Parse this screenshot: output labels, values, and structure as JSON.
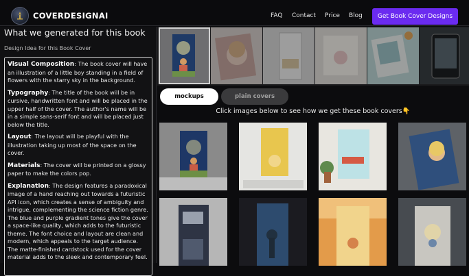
{
  "nav": {
    "brand": "COVERDESIGNAI",
    "links": [
      "FAQ",
      "Contact",
      "Price",
      "Blog"
    ],
    "cta": "Get Book Cover Designs"
  },
  "left": {
    "title": "What we generated for this book",
    "subtitle": "Design Idea for this Book Cover",
    "sections": [
      {
        "heading": "Visual Composition",
        "text": ": The book cover will have an illustration of a little boy standing in a field of flowers with the starry sky in the background."
      },
      {
        "heading": "Typography",
        "text": ": The title of the book will be in cursive, handwritten font and will be placed in the upper half of the cover. The author's name will be in a simple sans-serif font and will be placed just below the title."
      },
      {
        "heading": "Layout",
        "text": ": The layout will be playful with the illustration taking up most of the space on the cover."
      },
      {
        "heading": "Materials",
        "text": ": The cover will be printed on a glossy paper to make the colors pop."
      },
      {
        "heading": "Explanation",
        "text": ": The design features a paradoxical image of a hand reaching out towards a futuristic API icon, which creates a sense of ambiguity and intrigue, complementing the science fiction genre. The blue and purple gradient tones give the cover a space-like quality, which adds to the futuristic theme. The font choice and layout are clean and modern, which appeals to the target audience. The matte-finished cardstock used for the cover material adds to the sleek and contemporary feel."
      }
    ]
  },
  "tabs": {
    "active": "mockups",
    "inactive": "plain covers"
  },
  "hint": "Click images below to see how we get these book covers👇",
  "thumb_count": 6,
  "grid_count": 8
}
